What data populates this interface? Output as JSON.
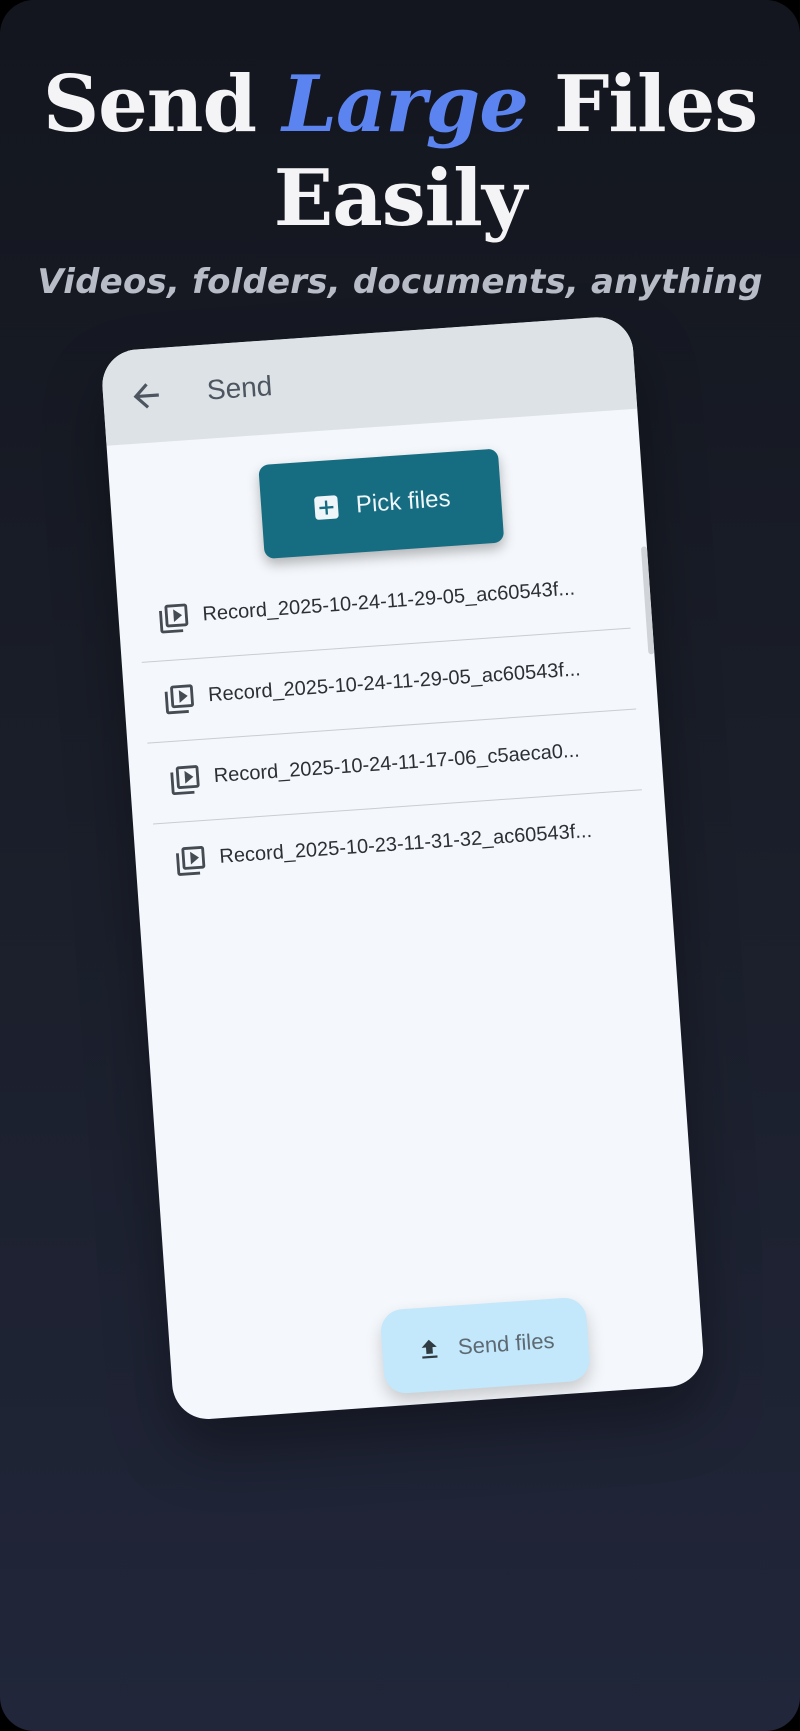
{
  "hero": {
    "title_part1": "Send ",
    "title_accent": "Large",
    "title_part2": " Files",
    "title_line2": "Easily",
    "subtitle": "Videos, folders, documents, anything",
    "accent_color": "#5b84f0"
  },
  "app": {
    "appbar": {
      "title": "Send",
      "back_icon": "arrow-back-icon"
    },
    "pick_button": {
      "label": "Pick files",
      "icon": "add-box-icon",
      "color": "#166c81"
    },
    "files": [
      {
        "name": "Record_2025-10-24-11-29-05_ac60543f...",
        "icon": "video-library-icon"
      },
      {
        "name": "Record_2025-10-24-11-29-05_ac60543f...",
        "icon": "video-library-icon"
      },
      {
        "name": "Record_2025-10-24-11-17-06_c5aeca0...",
        "icon": "video-library-icon"
      },
      {
        "name": "Record_2025-10-23-11-31-32_ac60543f...",
        "icon": "video-library-icon"
      }
    ],
    "send_button": {
      "label": "Send files",
      "icon": "upload-icon",
      "color": "#c3e7fb"
    }
  }
}
